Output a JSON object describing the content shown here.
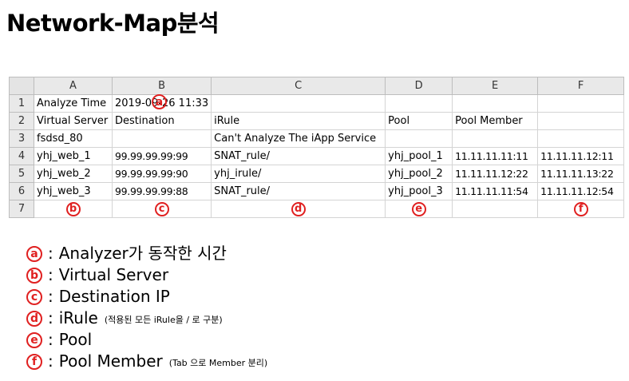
{
  "title": "Network-Map분석",
  "sheet": {
    "columns": [
      "A",
      "B",
      "C",
      "D",
      "E",
      "F"
    ],
    "rows": [
      {
        "num": "1",
        "cells": [
          "Analyze Time",
          "2019-09-26 11:33",
          "",
          "",
          "",
          ""
        ]
      },
      {
        "num": "2",
        "cells": [
          "Virtual Server",
          "Destination",
          "iRule",
          "Pool",
          "Pool Member",
          ""
        ]
      },
      {
        "num": "3",
        "cells": [
          "fsdsd_80",
          "",
          "Can't Analyze The iApp Service",
          "",
          "",
          ""
        ]
      },
      {
        "num": "4",
        "cells": [
          "yhj_web_1",
          "99.99.99.99:99",
          "SNAT_rule/",
          "yhj_pool_1",
          "11.11.11.11:11",
          "11.11.11.12:11"
        ]
      },
      {
        "num": "5",
        "cells": [
          "yhj_web_2",
          "99.99.99.99:90",
          "yhj_irule/",
          "yhj_pool_2",
          "11.11.11.12:22",
          "11.11.11.13:22"
        ]
      },
      {
        "num": "6",
        "cells": [
          "yhj_web_3",
          "99.99.99.99:88",
          "SNAT_rule/",
          "yhj_pool_3",
          "11.11.11.11:54",
          "11.11.11.12:54"
        ]
      },
      {
        "num": "7",
        "cells": [
          "ⓑ",
          "ⓒ",
          "ⓓ",
          "ⓔ",
          "",
          "ⓕ"
        ]
      }
    ],
    "markers": {
      "a": "a",
      "b": "b",
      "c": "c",
      "d": "d",
      "e": "e",
      "f": "f"
    }
  },
  "legend": [
    {
      "marker": "a",
      "sep": ":",
      "text": "Analyzer가 동작한 시간",
      "note": ""
    },
    {
      "marker": "b",
      "sep": ":",
      "text": "Virtual Server",
      "note": ""
    },
    {
      "marker": "c",
      "sep": ":",
      "text": "Destination IP",
      "note": ""
    },
    {
      "marker": "d",
      "sep": ":",
      "text": "iRule",
      "note": "(적용된 모든 iRule을 / 로 구분)"
    },
    {
      "marker": "e",
      "sep": ":",
      "text": "Pool",
      "note": ""
    },
    {
      "marker": "f",
      "sep": ":",
      "text": "Pool Member",
      "note": "(Tab 으로 Member 분리)"
    }
  ],
  "colors": {
    "marker": "#e02020",
    "header_bg": "#e9e9e9",
    "grid": "#d4d4d4"
  }
}
